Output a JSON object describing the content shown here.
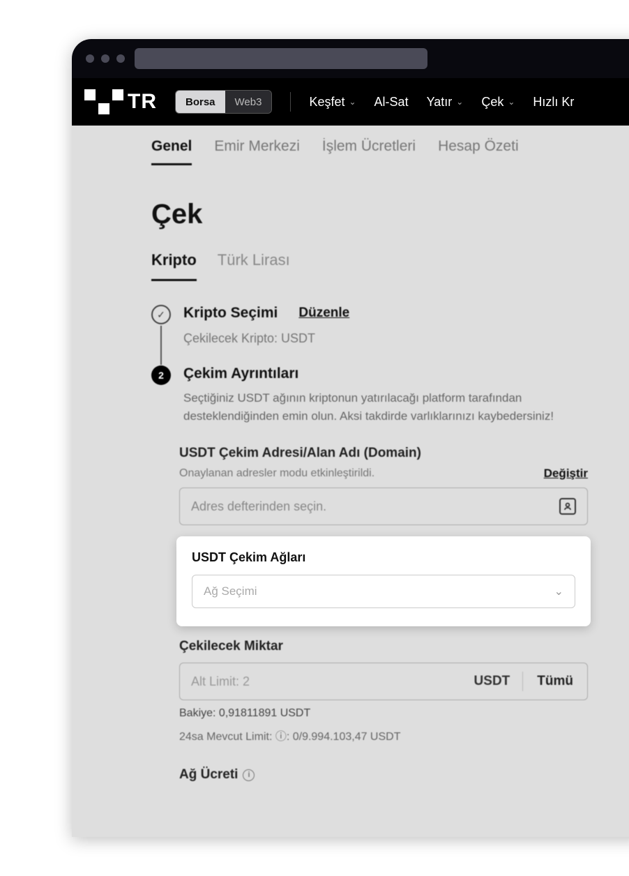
{
  "nav": {
    "toggle": {
      "borsa": "Borsa",
      "web3": "Web3"
    },
    "items": [
      "Keşfet",
      "Al-Sat",
      "Yatır",
      "Çek",
      "Hızlı Kr"
    ],
    "logo_suffix": "TR"
  },
  "subtabs": [
    "Genel",
    "Emir Merkezi",
    "İşlem Ücretleri",
    "Hesap Özeti"
  ],
  "page_title": "Çek",
  "currency_tabs": [
    "Kripto",
    "Türk Lirası"
  ],
  "step1": {
    "title": "Kripto Seçimi",
    "edit": "Düzenle",
    "note": "Çekilecek Kripto: USDT",
    "check": "✓"
  },
  "step2": {
    "num": "2",
    "title": "Çekim Ayrıntıları",
    "desc": "Seçtiğiniz USDT ağının kriptonun yatırılacağı platform tarafından desteklendiğinden emin olun. Aksi takdirde varlıklarınızı kaybedersiniz!"
  },
  "address": {
    "label": "USDT Çekim Adresi/Alan Adı (Domain)",
    "sub": "Onaylanan adresler modu etkinleştirildi.",
    "change": "Değiştir",
    "placeholder": "Adres defterinden seçin."
  },
  "networks": {
    "label": "USDT Çekim Ağları",
    "placeholder": "Ağ Seçimi"
  },
  "amount": {
    "label": "Çekilecek Miktar",
    "placeholder": "Alt Limit: 2",
    "unit": "USDT",
    "all": "Tümü",
    "balance": "Bakiye: 0,91811891 USDT",
    "limit": "24sa Mevcut Limit: ⓘ: 0/9.994.103,47 USDT"
  },
  "fee": {
    "label": "Ağ Ücreti"
  },
  "info_char": "i"
}
